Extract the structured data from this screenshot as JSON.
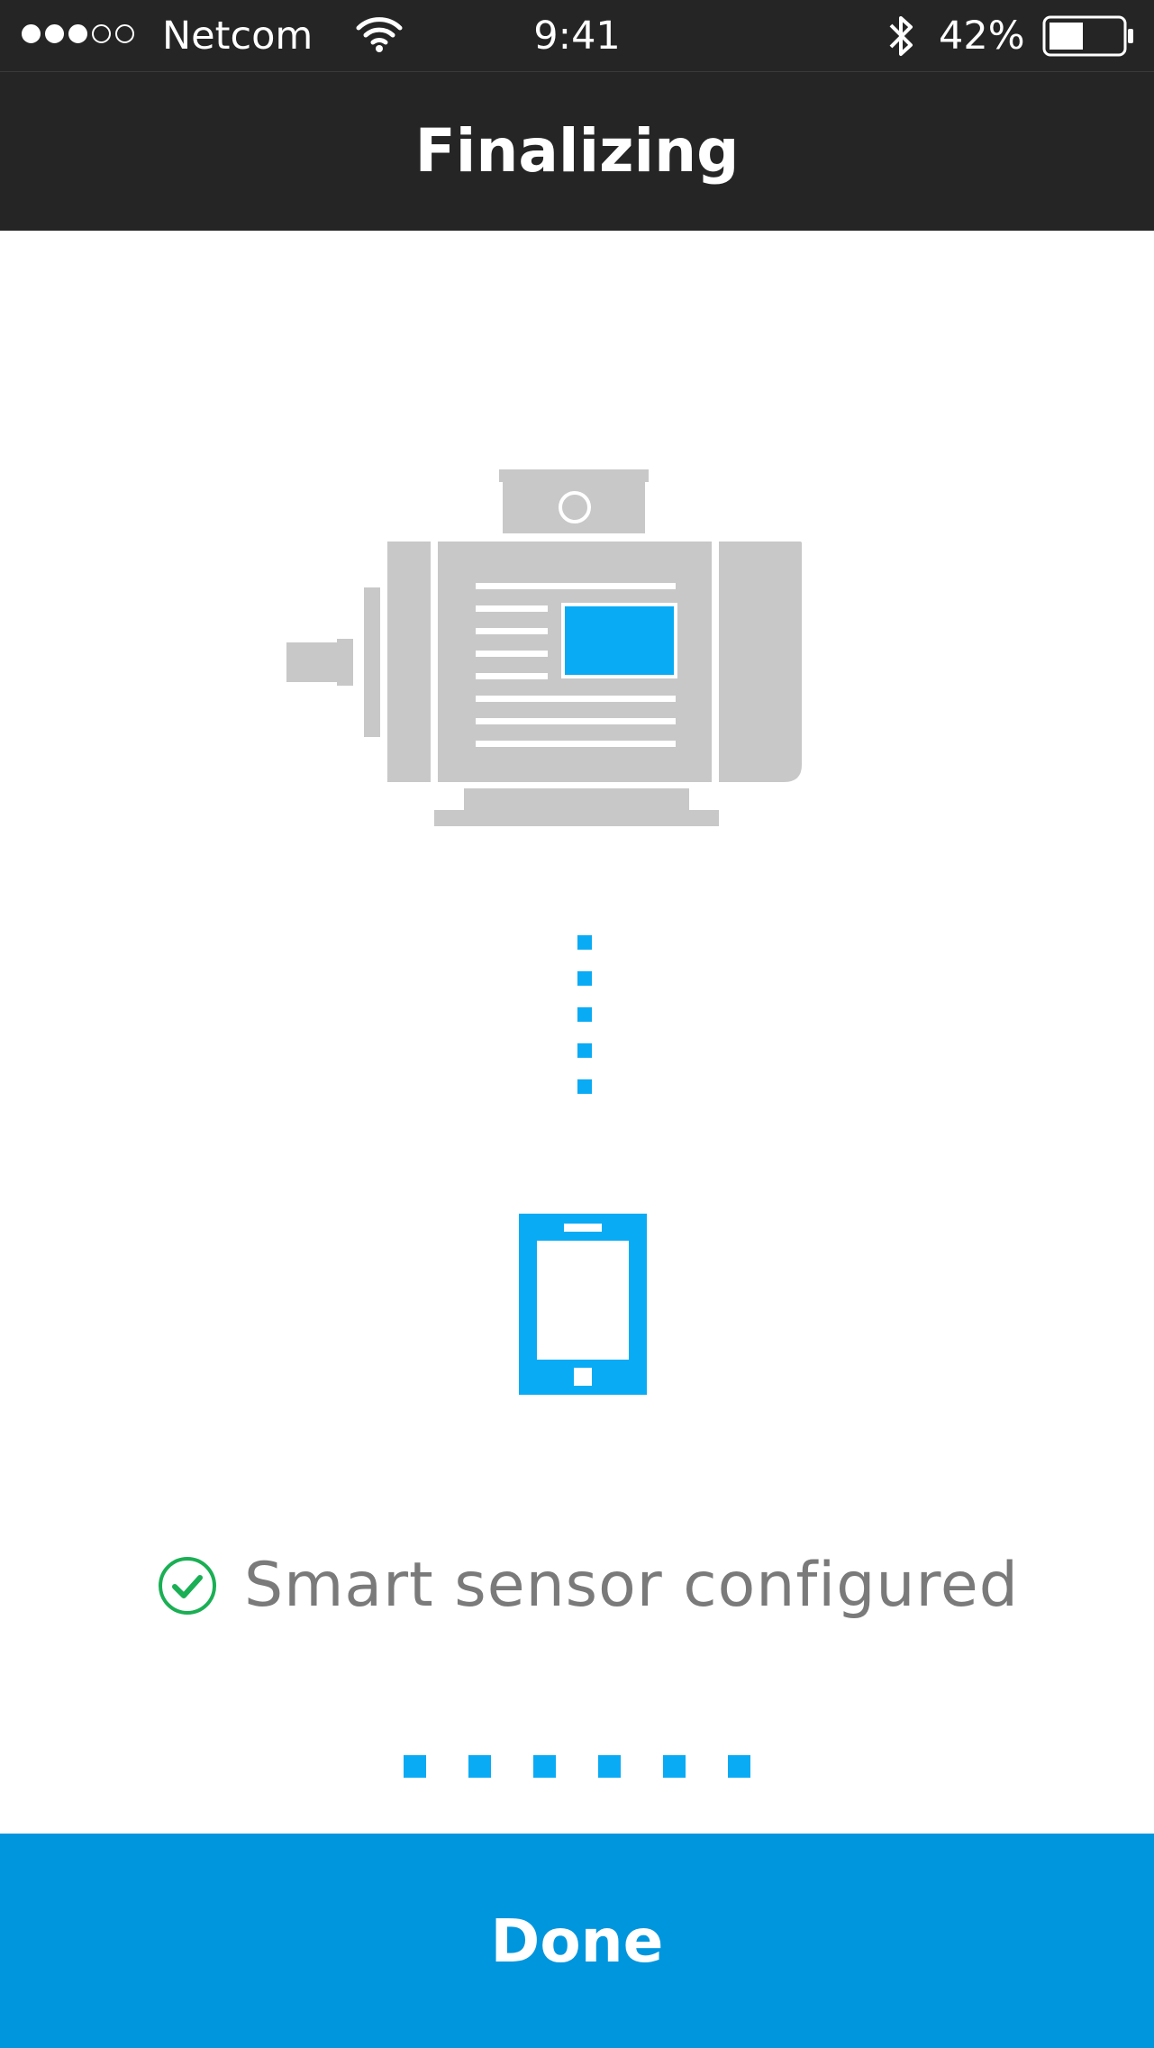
{
  "status_bar": {
    "carrier": "Netcom",
    "signal_strength": 3,
    "signal_max": 5,
    "time": "9:41",
    "battery_percent": "42%",
    "icons": [
      "wifi-icon",
      "bluetooth-icon",
      "battery-icon"
    ]
  },
  "nav": {
    "title": "Finalizing"
  },
  "illustration": {
    "machine": "electric-motor-icon",
    "device": "smartphone-icon",
    "accent_color": "#0aabf5"
  },
  "status": {
    "text": "Smart sensor configured",
    "icon": "check-circle-icon",
    "icon_color": "#1aaf54"
  },
  "progress_dots": {
    "count": 6
  },
  "actions": {
    "done_label": "Done",
    "color": "#0096de"
  }
}
